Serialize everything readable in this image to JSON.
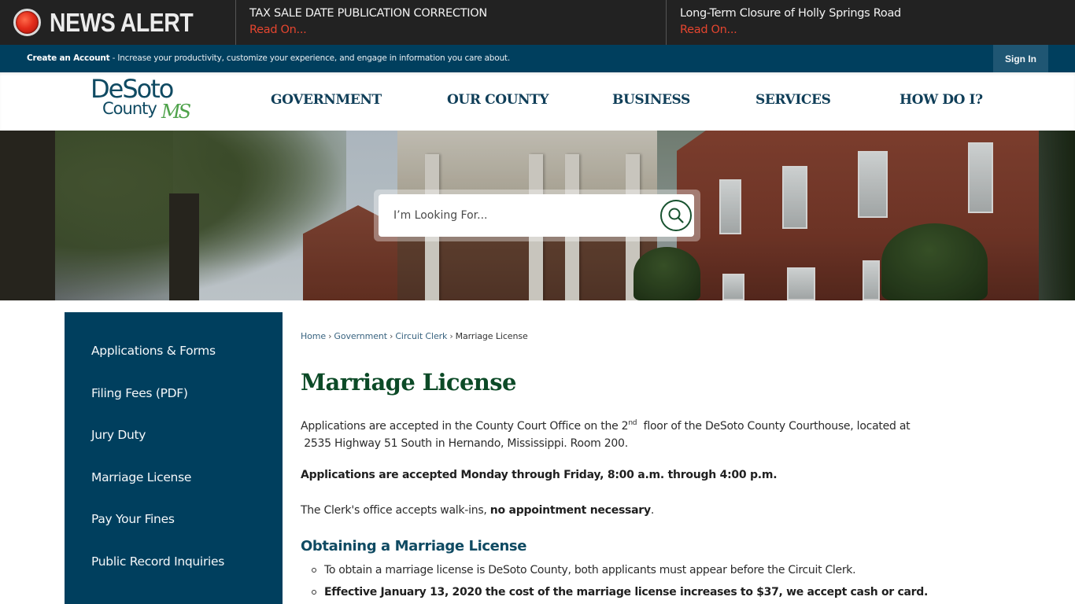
{
  "news_alert": {
    "title": "NEWS ALERT",
    "items": [
      {
        "headline": "TAX SALE DATE PUBLICATION CORRECTION",
        "link": "Read On..."
      },
      {
        "headline": "Long-Term Closure of Holly Springs Road",
        "link": "Read On..."
      }
    ]
  },
  "account_bar": {
    "create_account_label": "Create an Account",
    "message": " - Increase your productivity, customize your experience, and engage in information you care about.",
    "sign_in_label": "Sign In"
  },
  "header": {
    "logo": {
      "line1": "DeSoto",
      "line2": "County",
      "suffix": "MS"
    },
    "nav": [
      "GOVERNMENT",
      "OUR COUNTY",
      "BUSINESS",
      "SERVICES",
      "HOW DO I?"
    ]
  },
  "search": {
    "placeholder": "I’m Looking For...",
    "button_icon": "search-icon"
  },
  "sidebar": {
    "items": [
      "Applications & Forms",
      "Filing Fees (PDF)",
      "Jury Duty",
      "Marriage License",
      "Pay Your Fines",
      "Public Record Inquiries"
    ]
  },
  "breadcrumb": {
    "items": [
      "Home",
      "Government",
      "Circuit Clerk"
    ],
    "separator": "›",
    "current": "Marriage License"
  },
  "page": {
    "title": "Marriage License",
    "intro_line1_a": "Applications are accepted in the County Court Office on the 2",
    "intro_sup": "nd",
    "intro_line1_b": "  floor of the DeSoto County Courthouse, located at",
    "intro_line2": " 2535 Highway 51 South in Hernando, Mississippi. Room 200.",
    "hours": "Applications are accepted Monday through Friday, 8:00 a.m. through 4:00 p.m.",
    "walkins_a": "The Clerk's office accepts walk-ins, ",
    "walkins_bold": "no appointment necessary",
    "walkins_b": ".",
    "section_heading": "Obtaining a Marriage License",
    "bullets": [
      "To obtain a marriage license is DeSoto County, both applicants must appear before the Circuit Clerk.",
      "Effective January 13, 2020 the cost of the marriage license increases to $37, we accept cash or card."
    ]
  },
  "colors": {
    "alert_bg": "#222222",
    "alert_link": "#e5452f",
    "account_bar": "#003f5e",
    "sign_in_bg": "#1f5673",
    "nav_text": "#0f3e58",
    "sidebar_bg": "#003f5e",
    "title_green": "#0c4a27",
    "section_heading": "#0f4a62"
  }
}
